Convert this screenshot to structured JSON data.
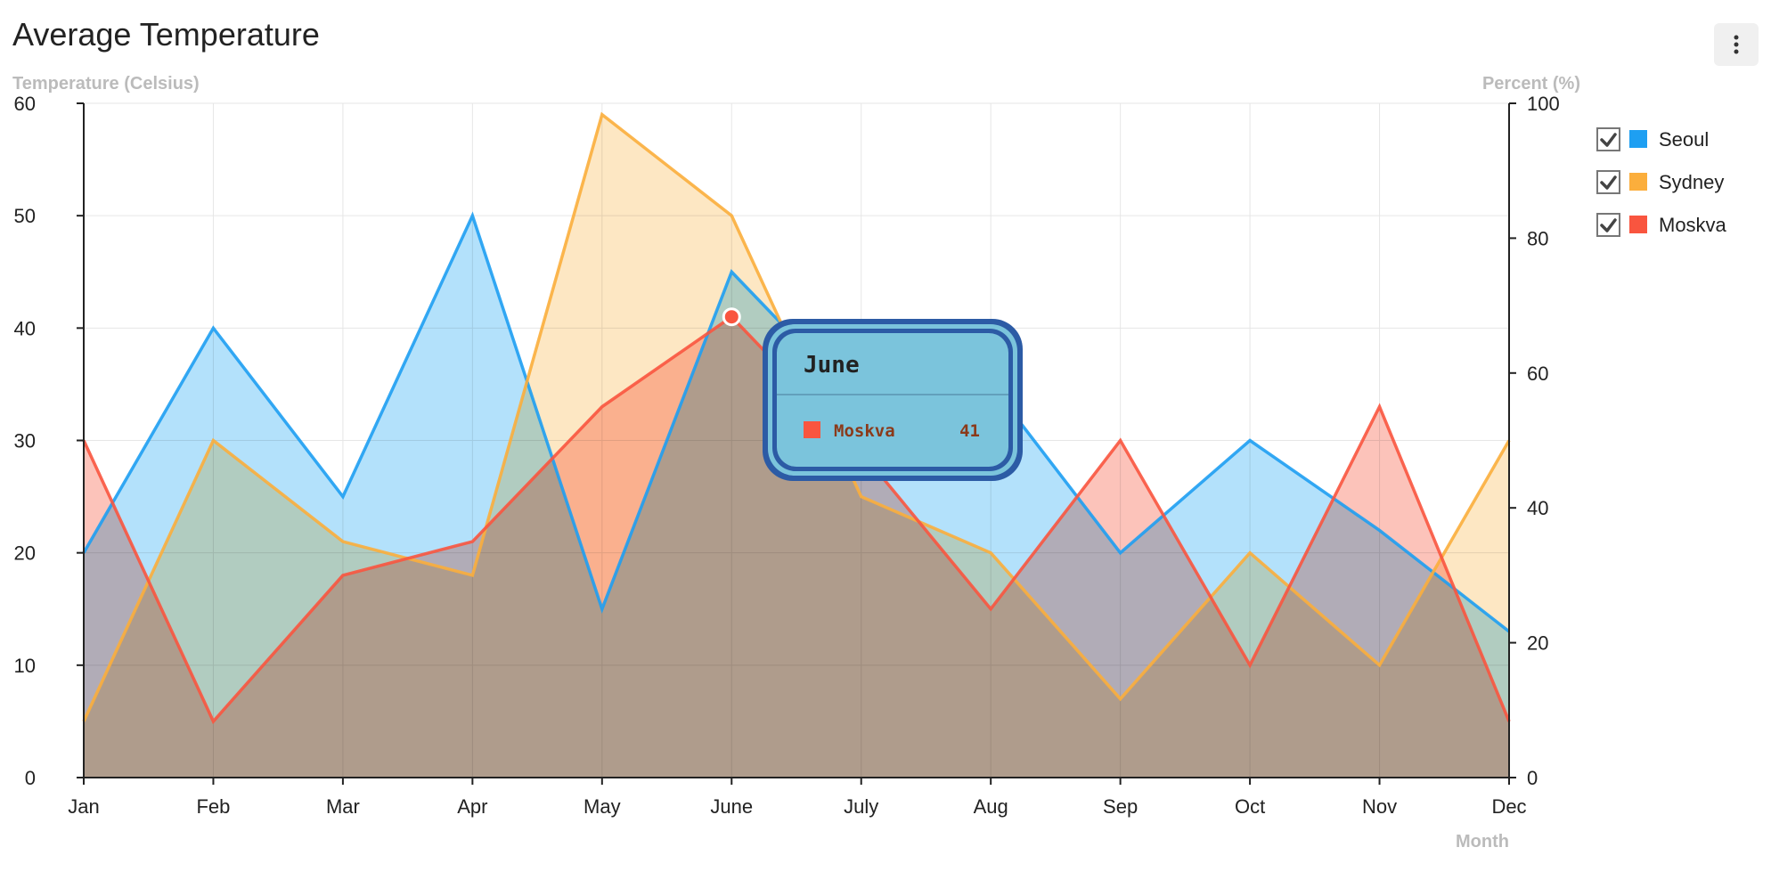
{
  "title": "Average Temperature",
  "menu_icon": "more-vertical-icon",
  "chart_data": {
    "type": "area",
    "title": "Average Temperature",
    "xlabel": "Month",
    "ylabel_left": "Temperature (Celsius)",
    "ylabel_right": "Percent (%)",
    "ylim_left": [
      0,
      60
    ],
    "ylim_right": [
      0,
      100
    ],
    "yticks_left": [
      0,
      10,
      20,
      30,
      40,
      50,
      60
    ],
    "yticks_right": [
      0,
      20,
      40,
      60,
      80,
      100
    ],
    "grid": true,
    "legend_position": "right",
    "categories": [
      "Jan",
      "Feb",
      "Mar",
      "Apr",
      "May",
      "June",
      "July",
      "Aug",
      "Sep",
      "Oct",
      "Nov",
      "Dec"
    ],
    "series": [
      {
        "name": "Seoul",
        "color": "#1e9ff2",
        "fill": "#a6dcfa",
        "values": [
          20,
          40,
          25,
          50,
          15,
          45,
          33,
          35,
          20,
          30,
          22,
          13
        ]
      },
      {
        "name": "Sydney",
        "color": "#fbae3c",
        "fill": "#fde3b8",
        "values": [
          5,
          30,
          21,
          18,
          59,
          50,
          25,
          20,
          7,
          20,
          10,
          30
        ]
      },
      {
        "name": "Moskva",
        "color": "#f9553f",
        "fill": "#fbb9ae",
        "values": [
          30,
          5,
          18,
          21,
          33,
          41,
          29,
          15,
          30,
          10,
          33,
          5
        ]
      }
    ]
  },
  "legend": [
    {
      "label": "Seoul",
      "checked": true
    },
    {
      "label": "Sydney",
      "checked": true
    },
    {
      "label": "Moskva",
      "checked": true
    }
  ],
  "tooltip": {
    "title": "June",
    "series": "Moskva",
    "value": "41",
    "color": "#f9553f"
  }
}
